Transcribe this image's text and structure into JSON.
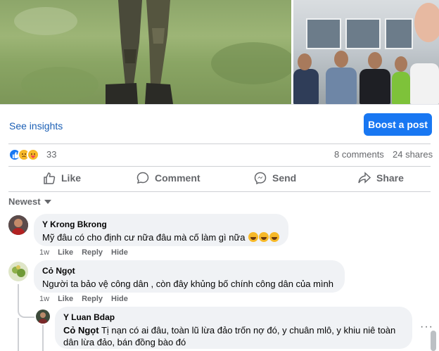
{
  "post": {
    "see_insights": "See insights",
    "boost_label": "Boost a post",
    "reaction_count": "33",
    "comments_count": "8 comments",
    "shares_count": "24 shares"
  },
  "actions": {
    "like": "Like",
    "comment": "Comment",
    "send": "Send",
    "share": "Share"
  },
  "sort": {
    "label": "Newest"
  },
  "comments": [
    {
      "name": "Y Krong Bkrong",
      "text": "Mỹ đâu có cho định cư nữa đâu mà cố làm gì nữa",
      "time": "1w",
      "like": "Like",
      "reply": "Reply",
      "hide": "Hide"
    },
    {
      "name": "Cỏ Ngọt",
      "text": "Người ta bảo vệ công dân , còn đây khủng bố chính công dân của mình",
      "time": "1w",
      "like": "Like",
      "reply": "Reply",
      "hide": "Hide"
    }
  ],
  "reply": {
    "name": "Y Luan Bdap",
    "mention": "Cỏ Ngọt",
    "text_line1": "Tị nạn có ai đâu, toàn lũ lừa đảo trốn nợ đó, y chuân mlô, y khiu niê toàn",
    "text_line2": "dân lừa đảo, bán đồng bào đó",
    "more": "···"
  },
  "colors": {
    "accent": "#1877f2",
    "link": "#1b5fb5",
    "bubble": "#f0f2f5",
    "muted": "#65676b"
  }
}
